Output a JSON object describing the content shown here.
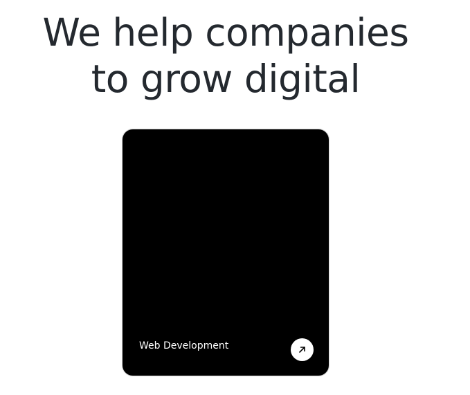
{
  "hero": {
    "headline_line1": "We help companies",
    "headline_line2": "to grow digital"
  },
  "service_card": {
    "label": "Web Development",
    "icon": "arrow-up-right-icon"
  },
  "colors": {
    "headline": "#24292f",
    "card_background": "#000000",
    "card_text": "#ffffff",
    "button_background": "#ffffff"
  }
}
